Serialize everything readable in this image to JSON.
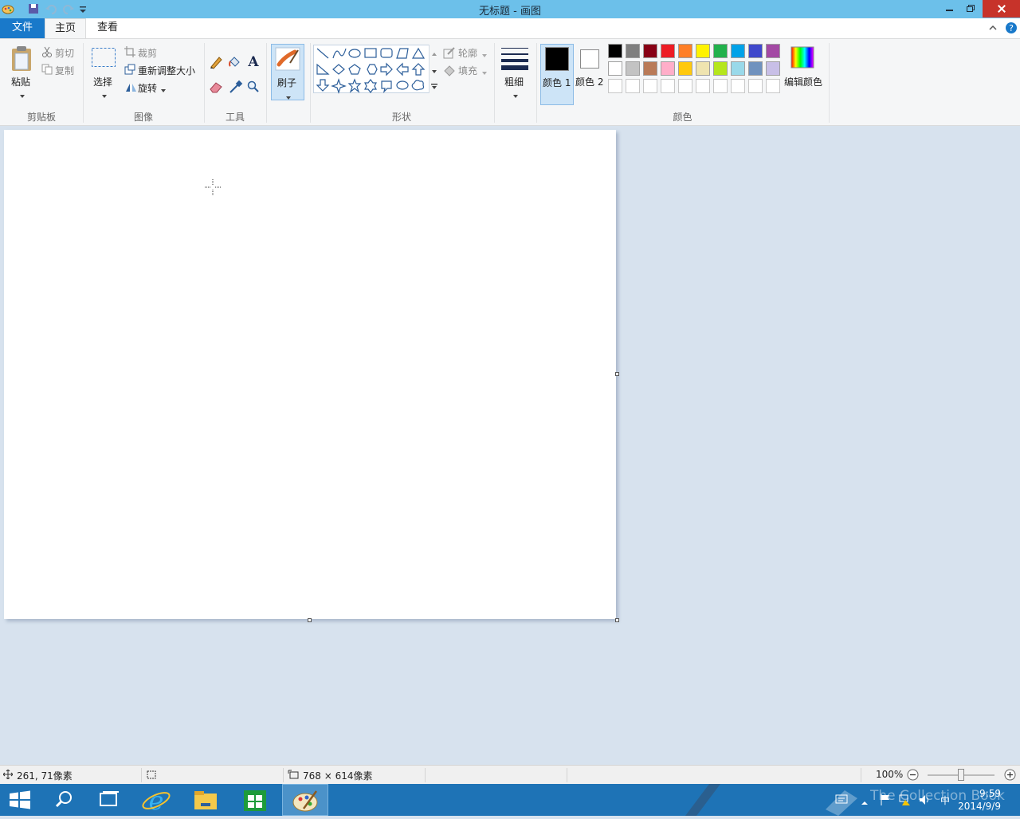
{
  "window": {
    "title": "无标题 - 画图"
  },
  "menu": {
    "file": "文件",
    "home": "主页",
    "view": "查看"
  },
  "ribbon": {
    "clipboard": {
      "paste": "粘贴",
      "cut": "剪切",
      "copy": "复制",
      "group": "剪贴板"
    },
    "image": {
      "select": "选择",
      "crop": "裁剪",
      "resize": "重新调整大小",
      "rotate": "旋转",
      "group": "图像"
    },
    "tools": {
      "group": "工具"
    },
    "brushes": {
      "label": "刷子"
    },
    "shapes": {
      "outline": "轮廓",
      "fill": "填充",
      "group": "形状"
    },
    "size": {
      "label": "粗细"
    },
    "colors": {
      "color1": "颜色 1",
      "color2": "颜色 2",
      "edit": "编辑颜色",
      "group": "颜色",
      "color1_value": "#000000",
      "color2_value": "#ffffff",
      "palette_row1": [
        "#000000",
        "#7f7f7f",
        "#880015",
        "#ed1c24",
        "#ff7f27",
        "#fff200",
        "#22b14c",
        "#00a2e8",
        "#3f48cc",
        "#a349a4"
      ],
      "palette_row2": [
        "#ffffff",
        "#c3c3c3",
        "#b97a57",
        "#ffaec9",
        "#ffc90e",
        "#efe4b0",
        "#b5e61d",
        "#99d9ea",
        "#7092be",
        "#c8bfe7"
      ]
    }
  },
  "status": {
    "cursor_pos": "261, 71像素",
    "canvas_size": "768 × 614像素",
    "zoom": "100%"
  },
  "taskbar": {
    "time": "9:59",
    "date": "2014/9/9",
    "watermark": "The Collection Book"
  }
}
